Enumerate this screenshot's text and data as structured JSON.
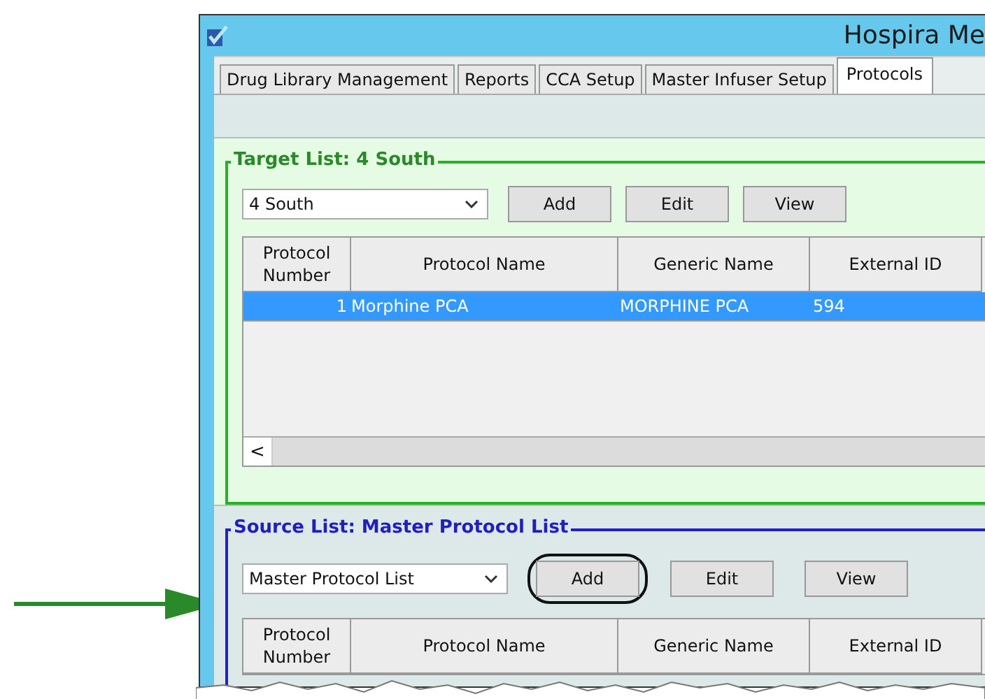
{
  "window": {
    "title": "Hospira Me"
  },
  "tabs": [
    {
      "label": "Drug Library Management",
      "selected": false
    },
    {
      "label": "Reports",
      "selected": false
    },
    {
      "label": "CCA Setup",
      "selected": false
    },
    {
      "label": "Master Infuser Setup",
      "selected": false
    },
    {
      "label": "Protocols",
      "selected": true
    }
  ],
  "target_list": {
    "title": "Target List: 4 South",
    "dropdown": "4 South",
    "buttons": [
      "Add",
      "Edit",
      "View"
    ],
    "columns": [
      "Protocol Number",
      "Protocol Name",
      "Generic Name",
      "External ID"
    ],
    "rows": [
      {
        "cells": [
          "1",
          "Morphine PCA",
          "MORPHINE PCA",
          "594"
        ],
        "selected": true
      }
    ],
    "scroll_left": "<"
  },
  "source_list": {
    "title": "Source List: Master Protocol List",
    "dropdown": "Master Protocol List",
    "buttons": [
      {
        "label": "Add",
        "highlighted": true
      },
      {
        "label": "Edit",
        "highlighted": false
      },
      {
        "label": "View",
        "highlighted": false
      }
    ],
    "columns": [
      "Protocol Number",
      "Protocol Name",
      "Generic Name",
      "External ID"
    ]
  }
}
